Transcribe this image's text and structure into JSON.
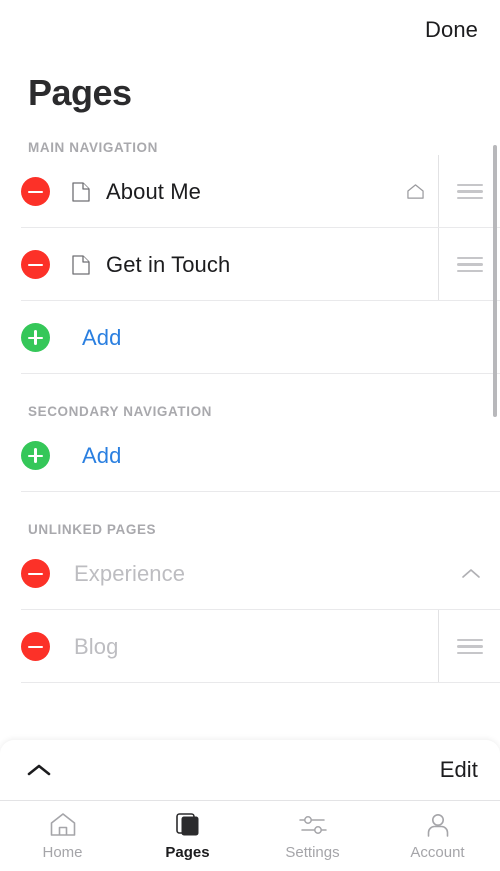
{
  "header": {
    "done_label": "Done",
    "title": "Pages"
  },
  "sections": [
    {
      "id": "main-navigation",
      "header": "MAIN NAVIGATION",
      "rows": [
        {
          "label": "About Me",
          "icon": "page-icon",
          "home": true,
          "drag": true
        },
        {
          "label": "Get in Touch",
          "icon": "page-icon",
          "home": false,
          "drag": true
        }
      ],
      "add_label": "Add"
    },
    {
      "id": "secondary-navigation",
      "header": "SECONDARY NAVIGATION",
      "rows": [],
      "add_label": "Add"
    },
    {
      "id": "unlinked-pages",
      "header": "UNLINKED PAGES",
      "rows": [
        {
          "label": "Experience",
          "muted": true,
          "chevron": "chevron-up"
        },
        {
          "label": "Blog",
          "muted": true,
          "drag": true
        }
      ]
    }
  ],
  "sheet": {
    "chevron": "chevron-up",
    "edit_label": "Edit"
  },
  "tabbar": {
    "items": [
      {
        "label": "Home",
        "icon": "home-icon",
        "active": false
      },
      {
        "label": "Pages",
        "icon": "pages-icon",
        "active": true
      },
      {
        "label": "Settings",
        "icon": "sliders-icon",
        "active": false
      },
      {
        "label": "Account",
        "icon": "person-icon",
        "active": false
      }
    ]
  },
  "colors": {
    "remove_red": "#FC3128",
    "add_green": "#35C759",
    "link_blue": "#2A7FE0",
    "text_dark": "#1C1C1E",
    "muted_gray": "#BDBDC1",
    "section_header_gray": "#A9A9AD"
  }
}
